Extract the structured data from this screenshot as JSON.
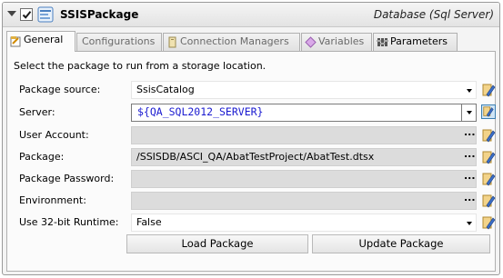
{
  "header": {
    "title": "SSISPackage",
    "subtitle": "Database (Sql Server)",
    "enabled": true
  },
  "tabs": [
    {
      "label": "General",
      "icon": "general-tab-icon",
      "active": true
    },
    {
      "label": "Configurations",
      "icon": "configurations-tab-icon",
      "active": false
    },
    {
      "label": "Connection Managers",
      "icon": "connection-managers-tab-icon",
      "active": false
    },
    {
      "label": "Variables",
      "icon": "variables-tab-icon",
      "active": false
    },
    {
      "label": "Parameters",
      "icon": "parameters-tab-icon",
      "active": false
    }
  ],
  "general": {
    "instructions": "Select the package to run from a storage location.",
    "fields": [
      {
        "label": "Package source:",
        "value": "SsisCatalog"
      },
      {
        "label": "Server:",
        "value": "${QA_SQL2012_SERVER}"
      },
      {
        "label": "User Account:",
        "value": ""
      },
      {
        "label": "Package:",
        "value": "/SSISDB/ASCI_QA/AbatTestProject/AbatTest.dtsx"
      },
      {
        "label": "Package Password:",
        "value": ""
      },
      {
        "label": "Environment:",
        "value": ""
      },
      {
        "label": "Use 32-bit Runtime:",
        "value": "False"
      }
    ],
    "ellipsis": "...",
    "buttons": {
      "load": "Load Package",
      "update": "Update Package"
    }
  },
  "colors": {
    "server_text": "#1a1ad0",
    "disabled_field": "#dcdcdc",
    "panel_bg": "#f4f4f4"
  }
}
